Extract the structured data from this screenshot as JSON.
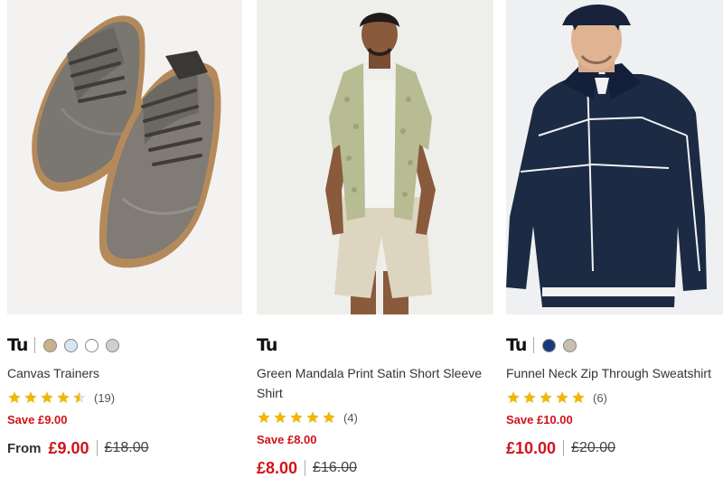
{
  "colors": {
    "accent": "#d1131a",
    "star": "#f2b705"
  },
  "products": [
    {
      "image_alt": "Canvas Trainers",
      "brand": "Tu",
      "swatches": [
        "#c9b28a",
        "#d8e4f0",
        "#ffffff",
        "#cfcfcf"
      ],
      "title": "Canvas Trainers",
      "rating": 4.5,
      "review_count": "(19)",
      "save": "Save £9.00",
      "from": "From",
      "price": "£9.00",
      "was": "£18.00"
    },
    {
      "image_alt": "Green Mandala Print Satin Short Sleeve Shirt",
      "brand": "Tu",
      "swatches": [],
      "title": "Green Mandala Print Satin Short Sleeve Shirt",
      "rating": 5,
      "review_count": "(4)",
      "save": "Save £8.00",
      "from": "",
      "price": "£8.00",
      "was": "£16.00"
    },
    {
      "image_alt": "Funnel Neck Zip Through Sweatshirt",
      "brand": "Tu",
      "swatches": [
        "#1a3a7a",
        "#c8bfae"
      ],
      "title": "Funnel Neck Zip Through Sweatshirt",
      "rating": 5,
      "review_count": "(6)",
      "save": "Save £10.00",
      "from": "",
      "price": "£10.00",
      "was": "£20.00"
    }
  ]
}
